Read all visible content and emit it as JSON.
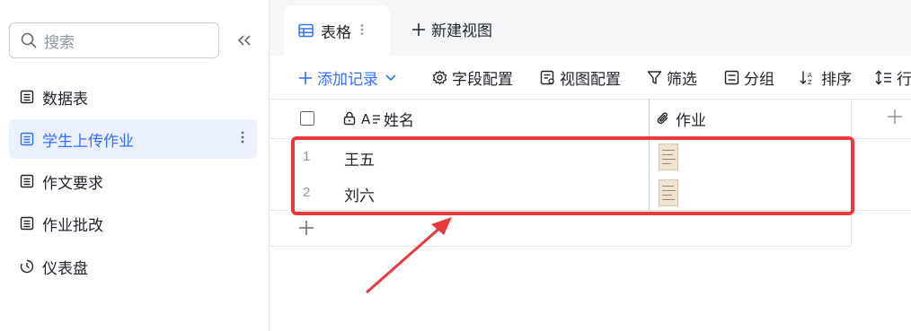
{
  "sidebar": {
    "search_placeholder": "搜索",
    "items": [
      {
        "label": "数据表",
        "icon": "table-icon",
        "active": false
      },
      {
        "label": "学生上传作业",
        "icon": "table-icon",
        "active": true
      },
      {
        "label": "作文要求",
        "icon": "table-icon",
        "active": false
      },
      {
        "label": "作业批改",
        "icon": "table-icon",
        "active": false
      },
      {
        "label": "仪表盘",
        "icon": "dashboard-icon",
        "active": false
      }
    ]
  },
  "tabs": {
    "active_label": "表格",
    "new_view_label": "新建视图"
  },
  "toolbar": {
    "add_record": "添加记录",
    "field_config": "字段配置",
    "view_config": "视图配置",
    "filter": "筛选",
    "group": "分组",
    "sort": "排序",
    "row_height": "行"
  },
  "table": {
    "columns": [
      {
        "label": "姓名",
        "icon": "text-field-icon"
      },
      {
        "label": "作业",
        "icon": "attachment-icon"
      }
    ],
    "rows": [
      {
        "num": "1",
        "name": "王五",
        "attachment": "image-thumbnail"
      },
      {
        "num": "2",
        "name": "刘六",
        "attachment": "image-thumbnail"
      }
    ]
  },
  "colors": {
    "accent": "#3370ff",
    "active_bg": "#eaf0fd",
    "annotation": "#e8393d"
  }
}
